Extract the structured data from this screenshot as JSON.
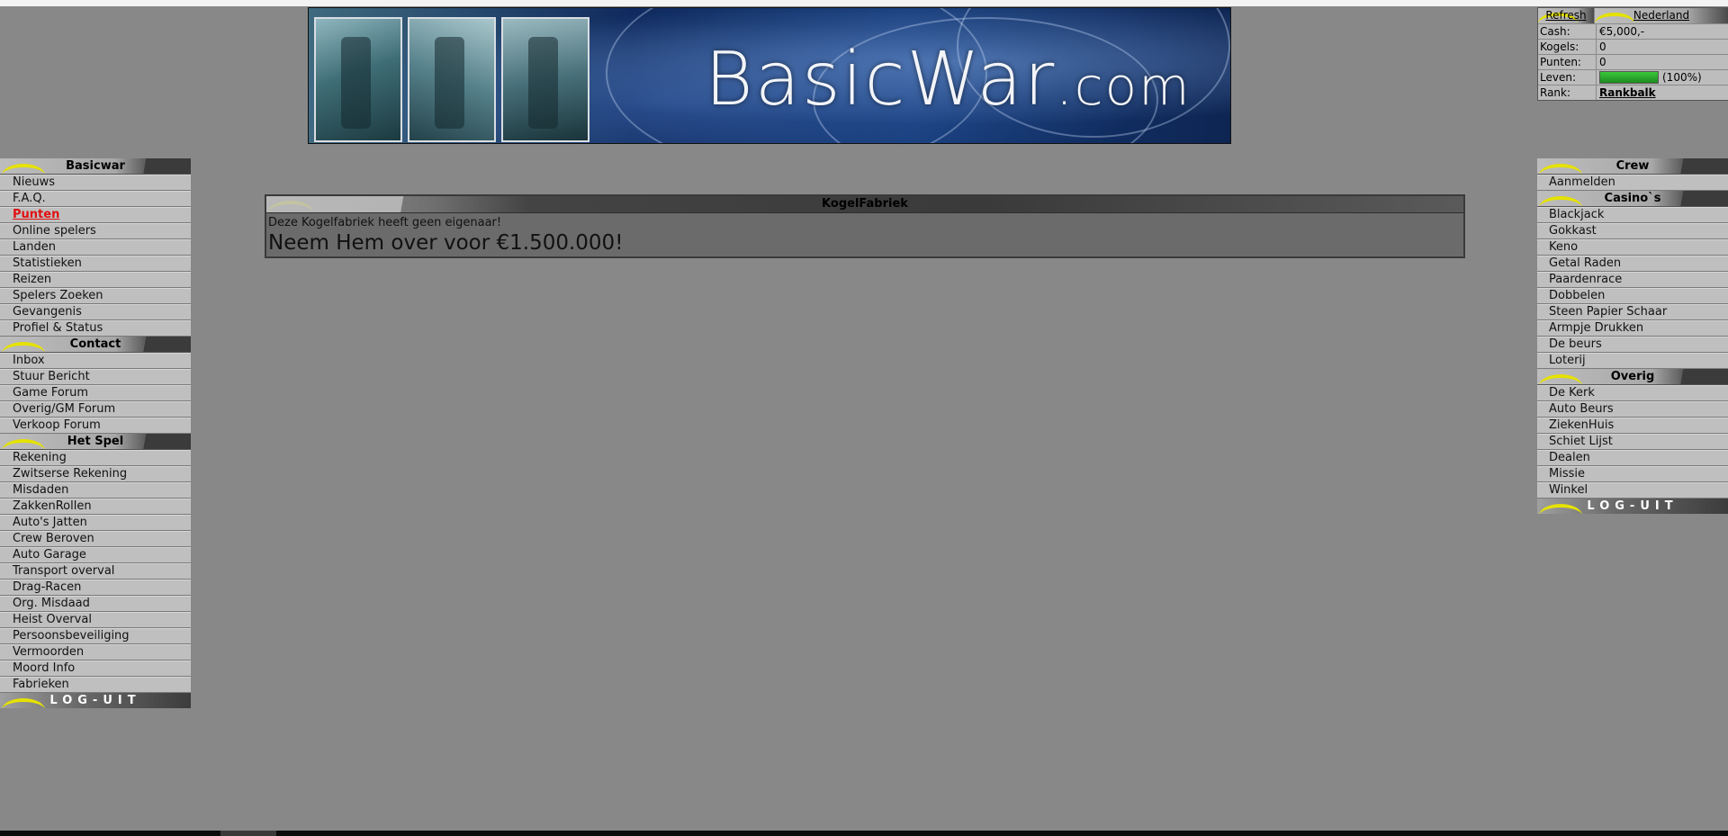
{
  "banner": {
    "title_main": "BasicWar",
    "title_suffix": ".com"
  },
  "status": {
    "refresh_label": "Refresh",
    "country_label": "Nederland",
    "rows": {
      "cash_label": "Cash:",
      "cash_value": "€5,000,-",
      "kogels_label": "Kogels:",
      "kogels_value": "0",
      "punten_label": "Punten:",
      "punten_value": "0",
      "leven_label": "Leven:",
      "leven_value": "(100%)",
      "leven_fraction": 1.0,
      "rank_label": "Rank:",
      "rank_value": "Rankbalk"
    },
    "bar_color": "#2fb52f",
    "accent_color": "#e6e200"
  },
  "left_menu": {
    "sections": [
      {
        "title": "Basicwar",
        "items": [
          "Nieuws",
          "F.A.Q.",
          "Punten",
          "Online spelers",
          "Landen",
          "Statistieken",
          "Reizen",
          "Spelers Zoeken",
          "Gevangenis",
          "Profiel & Status"
        ]
      },
      {
        "title": "Contact",
        "items": [
          "Inbox",
          "Stuur Bericht",
          "Game Forum",
          "Overig/GM Forum",
          "Verkoop Forum"
        ]
      },
      {
        "title": "Het Spel",
        "items": [
          "Rekening",
          "Zwitserse Rekening",
          "Misdaden",
          "ZakkenRollen",
          "Auto's Jatten",
          "Crew Beroven",
          "Auto Garage",
          "Transport overval",
          "Drag-Racen",
          "Org. Misdaad",
          "Heist Overval",
          "Persoonsbeveiliging",
          "Vermoorden",
          "Moord Info",
          "Fabrieken"
        ]
      }
    ],
    "active_item": "Punten",
    "logout_label": "LOG-UIT"
  },
  "right_menu": {
    "sections": [
      {
        "title": "Crew",
        "items": [
          "Aanmelden"
        ]
      },
      {
        "title": "Casino`s",
        "items": [
          "Blackjack",
          "Gokkast",
          "Keno",
          "Getal Raden",
          "Paardenrace",
          "Dobbelen",
          "Steen Papier Schaar",
          "Armpje Drukken",
          "De beurs",
          "Loterij"
        ]
      },
      {
        "title": "Overig",
        "items": [
          "De Kerk",
          "Auto Beurs",
          "ZiekenHuis",
          "Schiet Lijst",
          "Dealen",
          "Missie",
          "Winkel"
        ]
      }
    ],
    "logout_label": "LOG-UIT"
  },
  "main": {
    "panel_title": "KogelFabriek",
    "message": "Deze Kogelfabriek heeft geen eigenaar!",
    "offer": "Neem Hem over voor €1.500.000!"
  }
}
